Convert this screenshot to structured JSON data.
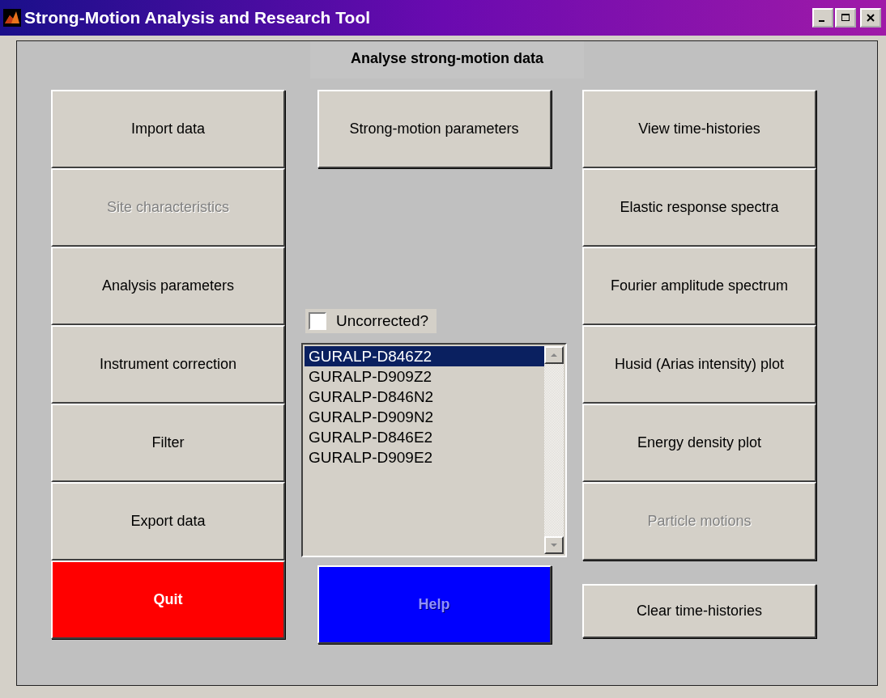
{
  "window": {
    "title": "Strong-Motion Analysis and Research Tool"
  },
  "heading": "Analyse strong-motion data",
  "left_buttons": [
    {
      "label": "Import data",
      "disabled": false
    },
    {
      "label": "Site characteristics",
      "disabled": true
    },
    {
      "label": "Analysis parameters",
      "disabled": false
    },
    {
      "label": "Instrument correction",
      "disabled": false
    },
    {
      "label": "Filter",
      "disabled": false
    },
    {
      "label": "Export data",
      "disabled": false
    }
  ],
  "quit_button": {
    "label": "Quit",
    "disabled": false
  },
  "parameters_button": {
    "label": "Strong-motion parameters",
    "disabled": false
  },
  "uncorrected_checkbox": {
    "label": "Uncorrected?",
    "checked": false
  },
  "records": [
    {
      "label": "GURALP-D846Z2",
      "selected": true
    },
    {
      "label": "GURALP-D909Z2",
      "selected": false
    },
    {
      "label": "GURALP-D846N2",
      "selected": false
    },
    {
      "label": "GURALP-D909N2",
      "selected": false
    },
    {
      "label": "GURALP-D846E2",
      "selected": false
    },
    {
      "label": "GURALP-D909E2",
      "selected": false
    }
  ],
  "help_button": {
    "label": "Help",
    "disabled": true
  },
  "right_buttons": [
    {
      "label": "View time-histories",
      "disabled": false
    },
    {
      "label": "Elastic response spectra",
      "disabled": false
    },
    {
      "label": "Fourier amplitude spectrum",
      "disabled": false
    },
    {
      "label": "Husid (Arias intensity) plot",
      "disabled": false
    },
    {
      "label": "Energy density plot",
      "disabled": false
    },
    {
      "label": "Particle motions",
      "disabled": true
    }
  ],
  "clear_button": {
    "label": "Clear time-histories",
    "disabled": false
  }
}
